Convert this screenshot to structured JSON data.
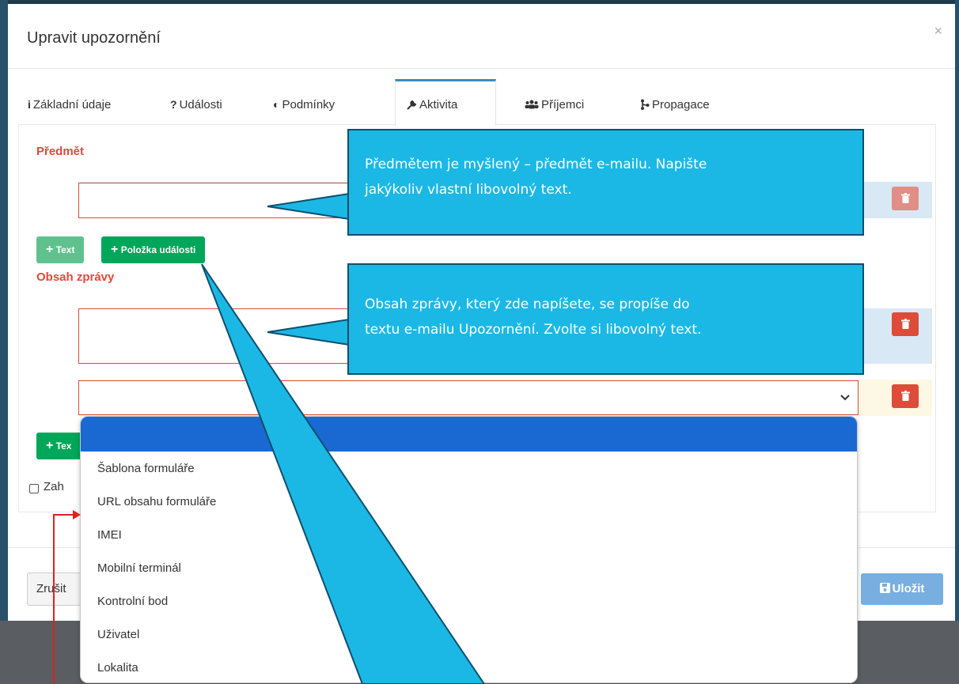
{
  "dialog": {
    "title": "Upravit upozornění",
    "close": "×"
  },
  "tabs": [
    {
      "icon": "info-icon",
      "glyph": "i",
      "label": "Základní údaje"
    },
    {
      "icon": "question-icon",
      "glyph": "?",
      "label": "Události"
    },
    {
      "icon": "half-circle-icon",
      "glyph": "◐",
      "label": "Podmínky"
    },
    {
      "icon": "wrench-icon",
      "glyph": "🔧",
      "label": "Aktivita",
      "active": true
    },
    {
      "icon": "users-icon",
      "glyph": "👥",
      "label": "Příjemci"
    },
    {
      "icon": "branch-icon",
      "glyph": "⑂",
      "label": "Propagace"
    }
  ],
  "subject": {
    "label": "Předmět",
    "add_text_label": "Text",
    "add_event_item_label": "Položka události",
    "plus": "+"
  },
  "message": {
    "label": "Obsah zprávy",
    "add_text_partial": "Tex"
  },
  "checkbox": {
    "label_partial": "Zah"
  },
  "dropdown": {
    "options": [
      "Šablona formuláře",
      "URL obsahu formuláře",
      "IMEI",
      "Mobilní terminál",
      "Kontrolní bod",
      "Uživatel",
      "Lokalita"
    ]
  },
  "footer": {
    "cancel_label": "Zrušit",
    "save_label": "Uložit"
  },
  "callouts": {
    "subject": [
      "Předmětem je myšlený – předmět e-mailu. Napište",
      "jakýkoliv vlastní libovolný text."
    ],
    "message": [
      "Obsah zprávy, který zde napíšete, se propíše do",
      "textu e-mailu Upozornění. Zvolte si libovolný text."
    ]
  },
  "colors": {
    "accent": "#3c8dbc",
    "danger": "#dd4b39",
    "success": "#00a65a",
    "callout": "#1bb8e5",
    "dropdown_selected": "#1a69d2"
  }
}
